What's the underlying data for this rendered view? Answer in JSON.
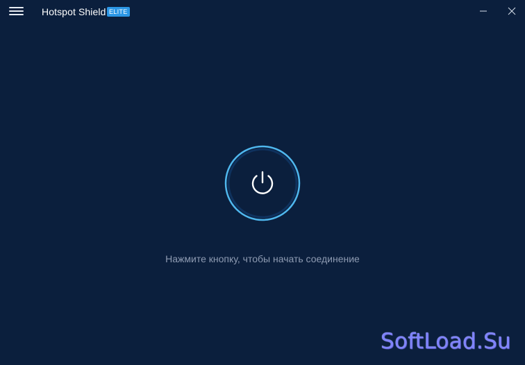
{
  "titlebar": {
    "menu_icon": "hamburger-menu-icon",
    "app_name": "Hotspot Shield",
    "badge": "ELITE",
    "badge_color": "#2c97e6",
    "minimize_icon": "minimize-icon",
    "close_icon": "close-icon"
  },
  "main": {
    "power_icon": "power-icon",
    "power_ring_color": "#4fb7ee",
    "hint": "Нажмите кнопку, чтобы начать соединение"
  },
  "watermark": {
    "text": "SoftLoad.Su",
    "color": "#7f83ff"
  },
  "colors": {
    "background": "#0b1f3d",
    "hint_text": "#8e9bb2"
  }
}
